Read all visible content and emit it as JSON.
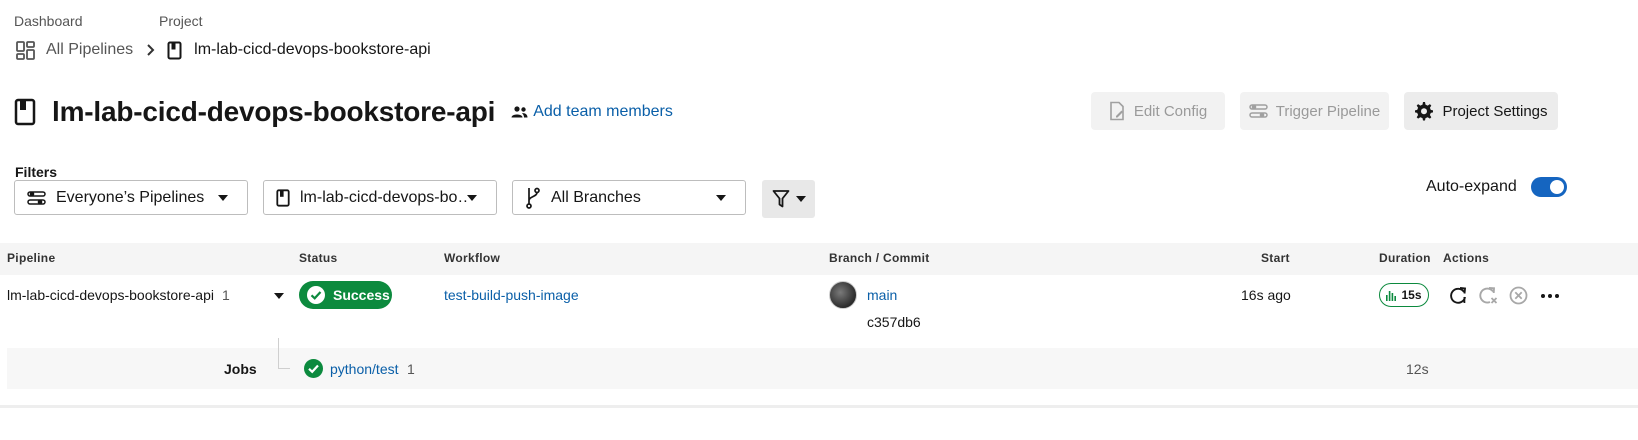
{
  "breadcrumb": {
    "dashboard_label": "Dashboard",
    "project_label": "Project",
    "all_pipelines": "All Pipelines",
    "project_name": "lm-lab-cicd-devops-bookstore-api"
  },
  "header": {
    "title": "lm-lab-cicd-devops-bookstore-api",
    "add_team_members": "Add team members",
    "edit_config": "Edit Config",
    "trigger_pipeline": "Trigger Pipeline",
    "project_settings": "Project Settings"
  },
  "filters": {
    "label": "Filters",
    "pipelines_select": "Everyone’s Pipelines",
    "project_select": "lm-lab-cicd-devops-bo…",
    "branch_select": "All Branches",
    "auto_expand_label": "Auto-expand",
    "auto_expand_on": true
  },
  "table": {
    "columns": {
      "pipeline": "Pipeline",
      "status": "Status",
      "workflow": "Workflow",
      "branch_commit": "Branch / Commit",
      "start": "Start",
      "duration": "Duration",
      "actions": "Actions"
    },
    "row": {
      "pipeline_name": "lm-lab-cicd-devops-bookstore-api",
      "pipeline_number": "1",
      "status": "Success",
      "workflow": "test-build-push-image",
      "branch": "main",
      "commit": "c357db6",
      "start": "16s ago",
      "duration": "15s"
    },
    "jobs": {
      "label": "Jobs",
      "job_name": "python/test",
      "job_number": "1",
      "job_duration": "12s"
    }
  },
  "colors": {
    "link": "#0a5fa8",
    "success": "#0c8a3e",
    "toggle": "#1565c0"
  },
  "icons": [
    "dashboard-icon",
    "chevron-right-icon",
    "bookmark-icon",
    "people-icon",
    "file-edit-icon",
    "sliders-icon",
    "gear-icon",
    "branch-icon",
    "filter-icon",
    "check-circle-icon",
    "bar-chart-icon",
    "rerun-icon",
    "rerun-failed-icon",
    "cancel-icon",
    "more-icon"
  ]
}
